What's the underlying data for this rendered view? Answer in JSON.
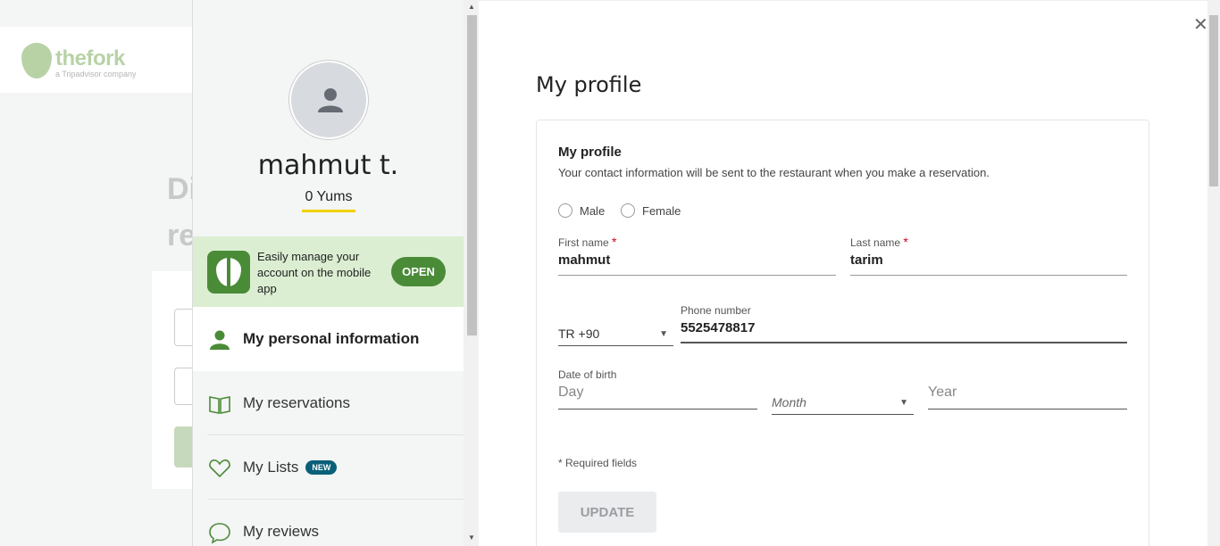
{
  "background": {
    "logo_word": "thefork",
    "logo_tag": "a Tripadvisor company",
    "hero_line1": "Di",
    "hero_line2": "re"
  },
  "sidebar": {
    "user_name": "mahmut t.",
    "yums": "0 Yums",
    "app_banner": {
      "text": "Easily manage your account on the mobile app",
      "button": "OPEN"
    },
    "items": [
      {
        "label": "My personal information",
        "icon": "person-icon",
        "active": true
      },
      {
        "label": "My reservations",
        "icon": "book-icon",
        "active": false
      },
      {
        "label": "My Lists",
        "icon": "heart-icon",
        "badge": "NEW",
        "active": false
      },
      {
        "label": "My reviews",
        "icon": "speech-bubble-icon",
        "active": false
      }
    ]
  },
  "main": {
    "close_icon": "close-icon",
    "page_title": "My profile",
    "card": {
      "title": "My profile",
      "subtitle": "Your contact information will be sent to the restaurant when you make a reservation.",
      "gender_options": [
        "Male",
        "Female"
      ],
      "first_name_label": "First name",
      "first_name_value": "mahmut",
      "last_name_label": "Last name",
      "last_name_value": "tarim",
      "required_mark": "*",
      "country_code": "TR +90",
      "phone_label": "Phone number",
      "phone_value": "5525478817",
      "dob_label": "Date of birth",
      "day_placeholder": "Day",
      "month_placeholder": "Month",
      "year_placeholder": "Year",
      "required_note": "* Required fields",
      "update_button": "UPDATE"
    }
  },
  "colors": {
    "brand_green": "#4a8b38",
    "banner_green": "#dbeed2",
    "yums_underline": "#f2d200",
    "badge_blue": "#0a5f79",
    "required_red": "#d0021b"
  }
}
